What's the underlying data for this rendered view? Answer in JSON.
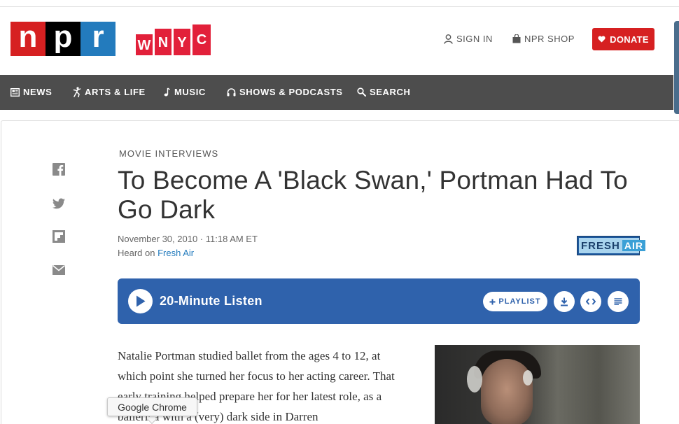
{
  "header": {
    "npr_letters": [
      "n",
      "p",
      "r"
    ],
    "wnyc_letters": [
      "W",
      "N",
      "Y",
      "C"
    ],
    "sign_in": "SIGN IN",
    "shop": "NPR SHOP",
    "donate": "DONATE"
  },
  "nav": {
    "items": [
      {
        "label": "NEWS",
        "icon": "newspaper-icon"
      },
      {
        "label": "ARTS & LIFE",
        "icon": "dancer-icon"
      },
      {
        "label": "MUSIC",
        "icon": "music-note-icon"
      },
      {
        "label": "SHOWS & PODCASTS",
        "icon": "headphones-icon"
      },
      {
        "label": "SEARCH",
        "icon": "search-icon"
      }
    ]
  },
  "article": {
    "slug": "MOVIE INTERVIEWS",
    "title": "To Become A 'Black Swan,' Portman Had To Go Dark",
    "date": "November 30, 2010 · 11:18 AM ET",
    "heard_on_prefix": "Heard on ",
    "heard_on_show": "Fresh Air",
    "body": "Natalie Portman studied ballet from the ages 4 to 12, at which point she turned her focus to her acting career. That early training helped prepare her for her latest role, as a ballerina with a (very) dark side in Darren"
  },
  "show_logo": {
    "fresh": "FRESH",
    "air": "AIR"
  },
  "player": {
    "listen_label": "20-Minute Listen",
    "playlist_label": "PLAYLIST",
    "accent": "#2f62ac"
  },
  "share": [
    "facebook-icon",
    "twitter-icon",
    "flipboard-icon",
    "email-icon"
  ],
  "tooltip": {
    "text": "Google Chrome"
  },
  "colors": {
    "npr_red": "#d62021",
    "npr_blue": "#237bbd",
    "wnyc_red": "#e2203a",
    "nav_bg": "#4d4d4d"
  }
}
